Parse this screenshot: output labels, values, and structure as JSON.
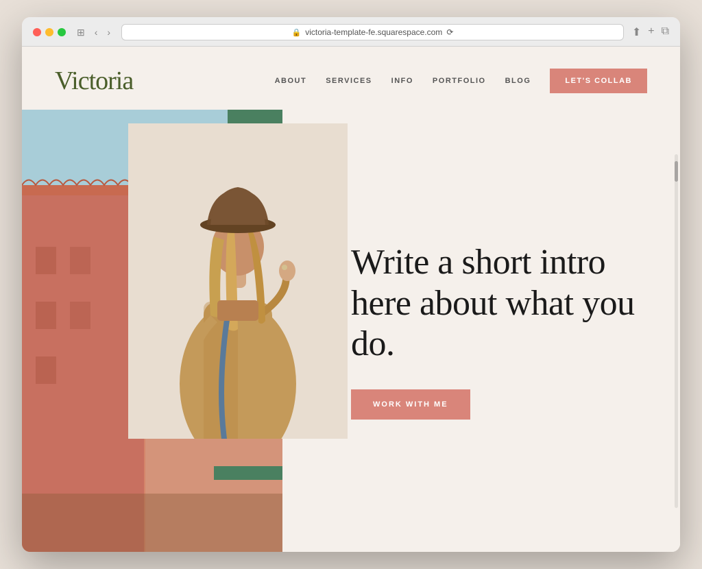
{
  "browser": {
    "url": "victoria-template-fe.squarespace.com",
    "reload_label": "⟳"
  },
  "site": {
    "logo": "Victoria",
    "nav": {
      "links": [
        "ABOUT",
        "SERVICES",
        "INFO",
        "PORTFOLIO",
        "BLOG"
      ],
      "cta_label": "LET'S COLLAB"
    },
    "hero": {
      "heading": "Write a short intro here about what you do.",
      "cta_label": "WORK WITH ME"
    }
  },
  "colors": {
    "logo_green": "#4a5e2a",
    "salmon": "#d9857a",
    "nav_text": "#555555",
    "heading_dark": "#1a1a1a",
    "bg_cream": "#f5f0eb"
  }
}
